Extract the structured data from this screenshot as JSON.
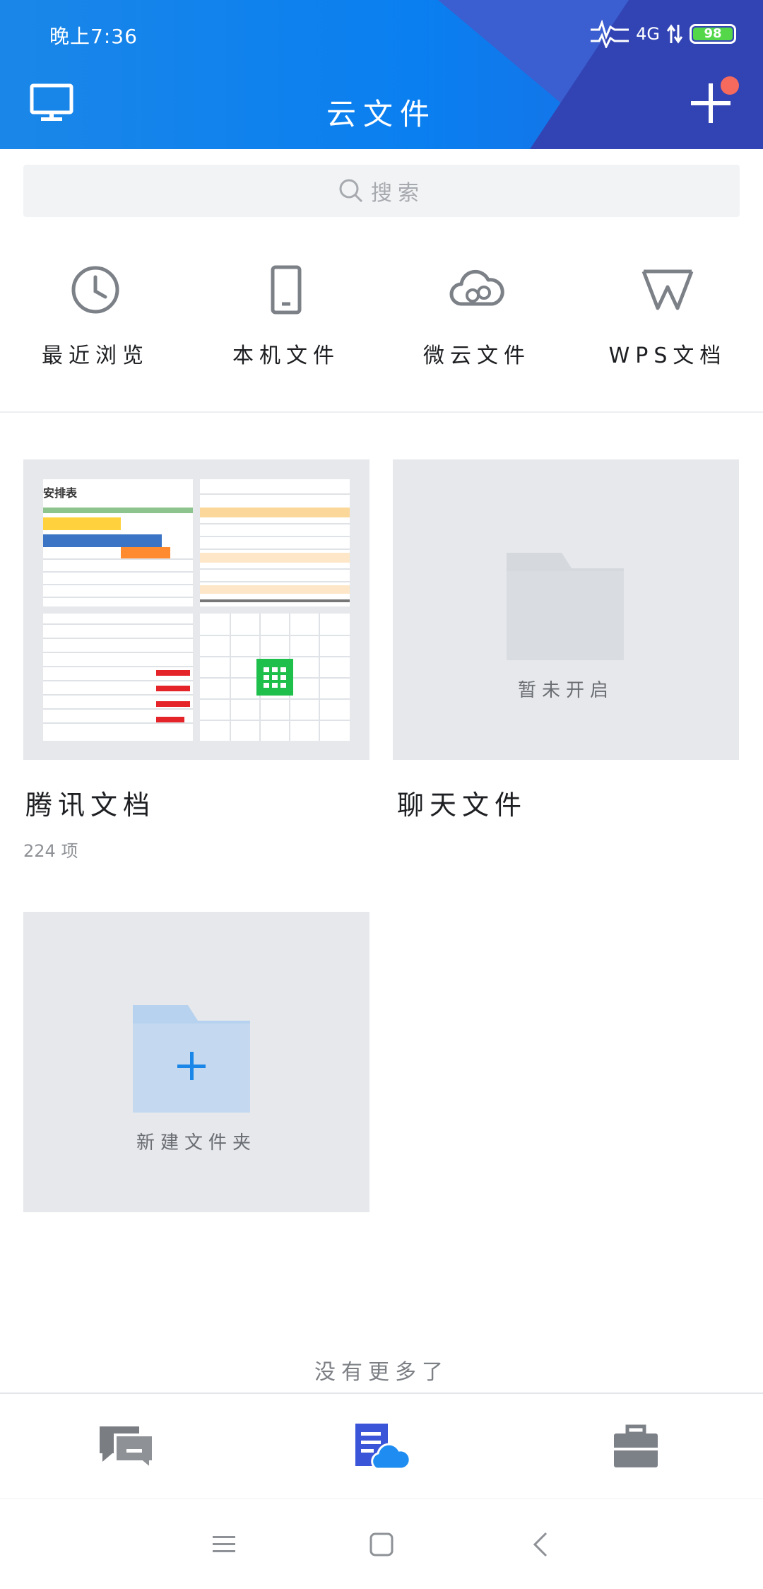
{
  "status_bar": {
    "time": "晚上7:36",
    "network": "4G",
    "battery": "98"
  },
  "header": {
    "title": "云文件",
    "left_icon": "monitor-icon",
    "right_icon": "plus-icon",
    "has_badge": true
  },
  "search": {
    "placeholder": "搜索"
  },
  "quick_entries": [
    {
      "label": "最近浏览",
      "icon": "clock-icon"
    },
    {
      "label": "本机文件",
      "icon": "phone-icon"
    },
    {
      "label": "微云文件",
      "icon": "cloud-icon"
    },
    {
      "label": "WPS文档",
      "icon": "wps-icon"
    }
  ],
  "folders": [
    {
      "title": "腾讯文档",
      "subtitle": "224 项",
      "preview_text": "安排表"
    },
    {
      "title": "聊天文件",
      "status": "暂未开启"
    }
  ],
  "new_folder": {
    "label": "新建文件夹"
  },
  "footer": {
    "no_more": "没有更多了"
  },
  "tabbar": [
    {
      "name": "messages",
      "icon": "chat-icon",
      "active": false
    },
    {
      "name": "files",
      "icon": "cloud-doc-icon",
      "active": true
    },
    {
      "name": "workbench",
      "icon": "briefcase-icon",
      "active": false
    }
  ],
  "colors": {
    "brand": "#1a86e8",
    "active_tab": "#3a55d8",
    "card_bg": "#e6e8ec",
    "folder_blue": "#c4d9f0"
  }
}
